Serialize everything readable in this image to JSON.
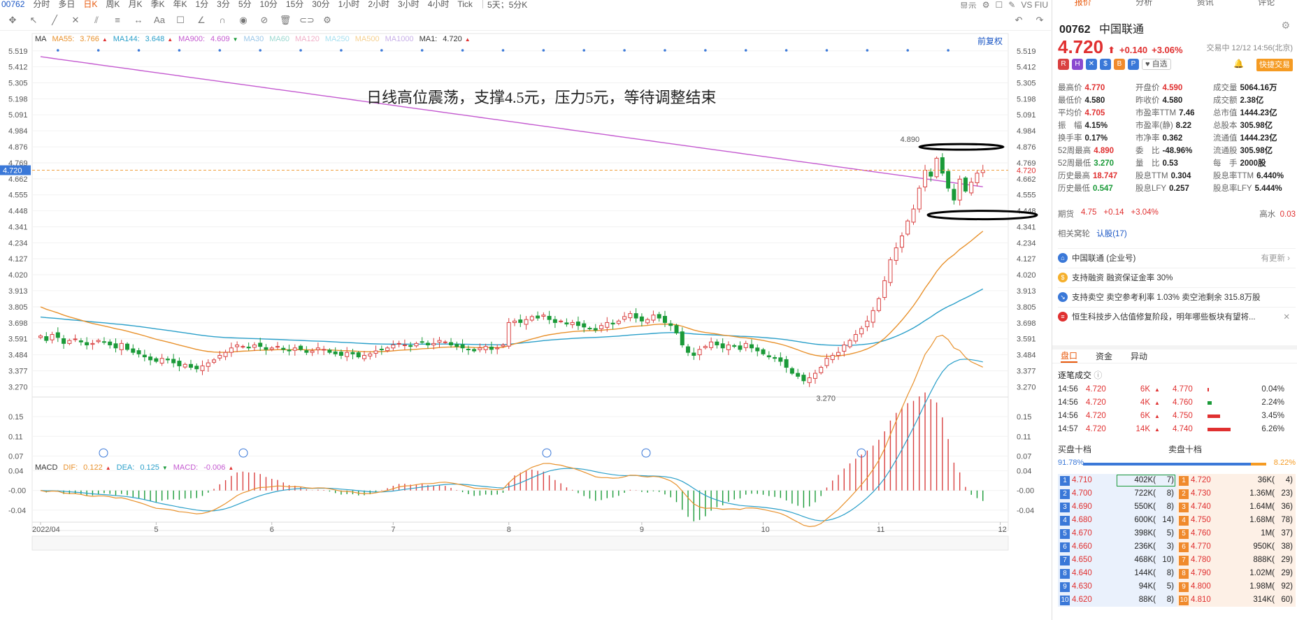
{
  "toolbar": {
    "code": "00762",
    "periods": [
      {
        "label": "分时",
        "active": false
      },
      {
        "label": "多日",
        "active": false
      },
      {
        "label": "日K",
        "active": true
      },
      {
        "label": "周K",
        "active": false
      },
      {
        "label": "月K",
        "active": false
      },
      {
        "label": "季K",
        "active": false
      },
      {
        "label": "年K",
        "active": false
      },
      {
        "label": "1分",
        "active": false
      },
      {
        "label": "3分",
        "active": false
      },
      {
        "label": "5分",
        "active": false
      },
      {
        "label": "10分",
        "active": false
      },
      {
        "label": "15分",
        "active": false
      },
      {
        "label": "30分",
        "active": false
      },
      {
        "label": "1小时",
        "active": false
      },
      {
        "label": "2小时",
        "active": false
      },
      {
        "label": "3小时",
        "active": false
      },
      {
        "label": "4小时",
        "active": false
      },
      {
        "label": "Tick",
        "active": false
      }
    ],
    "period_select": "5天；5分K",
    "display_label": "显示",
    "indicator_right": "VS FIU"
  },
  "chart": {
    "annotation": "日线高位震荡，支撑4.5元，压力5元，等待调整结束",
    "fuquan_label": "前复权",
    "current_price_tag": "4.720",
    "high_label": "4.890",
    "low_label": "3.270",
    "ma_legend": [
      {
        "label": "MA",
        "value": "",
        "color": "#333333"
      },
      {
        "label": "MA55:",
        "value": "3.766",
        "color": "#e8912c",
        "arrow": "▲"
      },
      {
        "label": "MA144:",
        "value": "3.648",
        "color": "#2a9fc9",
        "arrow": "▲"
      },
      {
        "label": "MA900:",
        "value": "4.609",
        "color": "#c45ad0",
        "arrow": "▼"
      },
      {
        "label": "MA30",
        "value": "",
        "color": "#9bc7e8"
      },
      {
        "label": "MA60",
        "value": "",
        "color": "#9bd8d0"
      },
      {
        "label": "MA120",
        "value": "",
        "color": "#f0b0c8"
      },
      {
        "label": "MA250",
        "value": "",
        "color": "#a8e0f0"
      },
      {
        "label": "MA500",
        "value": "",
        "color": "#f5d090"
      },
      {
        "label": "MA1000",
        "value": "",
        "color": "#c8b0e8"
      },
      {
        "label": "MA1:",
        "value": "4.720",
        "color": "#333333",
        "arrow": "▲"
      }
    ],
    "macd_legend": [
      {
        "label": "MACD",
        "value": "",
        "color": "#333333"
      },
      {
        "label": "DIF:",
        "value": "0.122",
        "color": "#e8912c",
        "arrow": "▲"
      },
      {
        "label": "DEA:",
        "value": "0.125",
        "color": "#2a9fc9",
        "arrow": "▼"
      },
      {
        "label": "MACD:",
        "value": "-0.006",
        "color": "#c45ad0",
        "arrow": "▲"
      }
    ],
    "price_ticks": [
      "5.519",
      "5.412",
      "5.305",
      "5.198",
      "5.091",
      "4.984",
      "4.876",
      "4.769",
      "4.662",
      "4.555",
      "4.448",
      "4.341",
      "4.234",
      "4.127",
      "4.020",
      "3.913",
      "3.805",
      "3.698",
      "3.591",
      "3.484",
      "3.377",
      "3.270"
    ],
    "macd_ticks": [
      "0.15",
      "0.11",
      "0.07",
      "0.04",
      "-0.00",
      "-0.04"
    ],
    "x_labels": [
      "2022/04",
      "5",
      "6",
      "7",
      "8",
      "9",
      "10",
      "11",
      "12"
    ]
  },
  "chart_data": {
    "type": "candlestick",
    "price_range": [
      3.22,
      5.56
    ],
    "macd_range": [
      -0.06,
      0.17
    ],
    "months": [
      {
        "label": "2022/04",
        "start_index": 0
      },
      {
        "label": "5",
        "start_index": 20
      },
      {
        "label": "6",
        "start_index": 40
      },
      {
        "label": "7",
        "start_index": 61
      },
      {
        "label": "8",
        "start_index": 81
      },
      {
        "label": "9",
        "start_index": 104
      },
      {
        "label": "10",
        "start_index": 125
      },
      {
        "label": "11",
        "start_index": 145
      },
      {
        "label": "12",
        "start_index": 166
      }
    ],
    "closes": [
      3.61,
      3.58,
      3.62,
      3.6,
      3.56,
      3.58,
      3.59,
      3.57,
      3.55,
      3.56,
      3.58,
      3.57,
      3.55,
      3.53,
      3.56,
      3.52,
      3.5,
      3.49,
      3.47,
      3.45,
      3.44,
      3.46,
      3.45,
      3.43,
      3.41,
      3.42,
      3.4,
      3.39,
      3.41,
      3.43,
      3.45,
      3.48,
      3.5,
      3.53,
      3.55,
      3.54,
      3.53,
      3.55,
      3.54,
      3.52,
      3.53,
      3.54,
      3.52,
      3.51,
      3.53,
      3.52,
      3.5,
      3.51,
      3.53,
      3.52,
      3.5,
      3.49,
      3.48,
      3.5,
      3.49,
      3.47,
      3.48,
      3.49,
      3.51,
      3.52,
      3.53,
      3.55,
      3.56,
      3.55,
      3.54,
      3.56,
      3.57,
      3.55,
      3.56,
      3.58,
      3.57,
      3.55,
      3.54,
      3.53,
      3.52,
      3.51,
      3.53,
      3.54,
      3.52,
      3.53,
      3.55,
      3.7,
      3.71,
      3.7,
      3.72,
      3.74,
      3.73,
      3.75,
      3.72,
      3.7,
      3.71,
      3.69,
      3.7,
      3.68,
      3.67,
      3.66,
      3.65,
      3.68,
      3.7,
      3.69,
      3.71,
      3.74,
      3.76,
      3.73,
      3.71,
      3.72,
      3.75,
      3.73,
      3.7,
      3.68,
      3.63,
      3.55,
      3.5,
      3.48,
      3.52,
      3.54,
      3.57,
      3.55,
      3.53,
      3.55,
      3.54,
      3.52,
      3.56,
      3.53,
      3.51,
      3.49,
      3.47,
      3.46,
      3.44,
      3.4,
      3.36,
      3.34,
      3.31,
      3.33,
      3.36,
      3.4,
      3.46,
      3.48,
      3.5,
      3.55,
      3.58,
      3.62,
      3.66,
      3.71,
      3.78,
      3.86,
      3.98,
      4.12,
      4.2,
      4.28,
      4.38,
      4.46,
      4.6,
      4.72,
      4.68,
      4.8,
      4.7,
      4.6,
      4.52,
      4.66,
      4.58,
      4.64,
      4.7,
      4.72
    ],
    "ma900": {
      "start": 5.48,
      "end": 4.609
    },
    "ma55_last": 3.766,
    "ma144_last": 3.648,
    "high": 4.89,
    "low": 3.27,
    "macd": {
      "dif": 0.122,
      "dea": 0.125,
      "macd": -0.006
    }
  },
  "panel": {
    "tabs": [
      {
        "label": "报价",
        "active": true
      },
      {
        "label": "分析",
        "active": false
      },
      {
        "label": "资讯",
        "active": false
      },
      {
        "label": "评论",
        "active": false
      }
    ],
    "code": "00762",
    "name": "中国联通",
    "price": "4.720",
    "arrow": "⬆",
    "change": "+0.140",
    "change_pct": "+3.06%",
    "trade_time": "交易中 12/12 14:56(北京)",
    "fav_label": "自选",
    "quick_trade": "快捷交易",
    "flags": [
      {
        "sym": "R",
        "color": "#d94040"
      },
      {
        "sym": "H",
        "color": "#8a4ad0"
      },
      {
        "sym": "✕",
        "color": "#3a78d8"
      },
      {
        "sym": "$",
        "color": "#3a78d8"
      },
      {
        "sym": "B",
        "color": "#f08a2c"
      },
      {
        "sym": "P",
        "color": "#3a78d8"
      }
    ],
    "quote_items": [
      {
        "label": "最高价",
        "value": "4.770",
        "tone": "red"
      },
      {
        "label": "开盘价",
        "value": "4.590",
        "tone": "red"
      },
      {
        "label": "成交量",
        "value": "5064.16万",
        "tone": "dark"
      },
      {
        "label": "最低价",
        "value": "4.580",
        "tone": "dark"
      },
      {
        "label": "昨收价",
        "value": "4.580",
        "tone": "dark"
      },
      {
        "label": "成交额",
        "value": "2.38亿",
        "tone": "dark"
      },
      {
        "label": "平均价",
        "value": "4.705",
        "tone": "red"
      },
      {
        "label": "市盈率TTM",
        "value": "7.46",
        "tone": "dark"
      },
      {
        "label": "总市值",
        "value": "1444.23亿",
        "tone": "dark"
      },
      {
        "label": "振　幅",
        "value": "4.15%",
        "tone": "dark"
      },
      {
        "label": "市盈率(静)",
        "value": "8.22",
        "tone": "dark"
      },
      {
        "label": "总股本",
        "value": "305.98亿",
        "tone": "dark"
      },
      {
        "label": "换手率",
        "value": "0.17%",
        "tone": "dark"
      },
      {
        "label": "市净率",
        "value": "0.362",
        "tone": "dark"
      },
      {
        "label": "流通值",
        "value": "1444.23亿",
        "tone": "dark"
      },
      {
        "label": "52周最高",
        "value": "4.890",
        "tone": "red"
      },
      {
        "label": "委　比",
        "value": "-48.96%",
        "tone": "dark"
      },
      {
        "label": "流通股",
        "value": "305.98亿",
        "tone": "dark"
      },
      {
        "label": "52周最低",
        "value": "3.270",
        "tone": "green"
      },
      {
        "label": "量　比",
        "value": "0.53",
        "tone": "dark"
      },
      {
        "label": "每　手",
        "value": "2000股",
        "tone": "dark"
      },
      {
        "label": "历史最高",
        "value": "18.747",
        "tone": "red"
      },
      {
        "label": "股息TTM",
        "value": "0.304",
        "tone": "dark"
      },
      {
        "label": "股息率TTM",
        "value": "6.440%",
        "tone": "dark"
      },
      {
        "label": "历史最低",
        "value": "0.547",
        "tone": "green"
      },
      {
        "label": "股息LFY",
        "value": "0.257",
        "tone": "dark"
      },
      {
        "label": "股息率LFY",
        "value": "5.444%",
        "tone": "dark"
      }
    ],
    "futures": {
      "label": "期货",
      "price": "4.75",
      "chg": "+0.14",
      "pct": "+3.04%",
      "hs_label": "高水",
      "hs_value": "0.03"
    },
    "related": {
      "label": "相关窝轮",
      "link": "认股(17)"
    },
    "notices": [
      {
        "text": "中国联通 (企业号)",
        "more": "有更新 ›",
        "icon": "⌂",
        "color": "#3a78d8"
      },
      {
        "text": "支持融资 融资保证金率 30%",
        "more": "",
        "icon": "$",
        "color": "#f5b02c"
      },
      {
        "text": "支持卖空 卖空参考利率 1.03% 卖空池剩余 315.8万股",
        "more": "",
        "icon": "↘",
        "color": "#3a78d8"
      },
      {
        "text": "恒生科技步入估值修复阶段，明年哪些板块有望将...",
        "more": "✕",
        "icon": "≡",
        "color": "#e03030"
      }
    ],
    "pan_tabs": [
      "盘口",
      "资金",
      "异动"
    ],
    "zb_title": "逐笔成交",
    "ticks": [
      {
        "time": "14:56",
        "price": "4.720",
        "vol": "6K",
        "dir": "▲",
        "lp": "4.770",
        "bar": 0.02,
        "bar_color": "#e03030",
        "pct": "0.04%"
      },
      {
        "time": "14:56",
        "price": "4.720",
        "vol": "4K",
        "dir": "▲",
        "lp": "4.760",
        "bar": 0.1,
        "bar_color": "#1a9a38",
        "pct": "2.24%"
      },
      {
        "time": "14:56",
        "price": "4.720",
        "vol": "6K",
        "dir": "▲",
        "lp": "4.750",
        "bar": 0.3,
        "bar_color": "#e03030",
        "pct": "3.45%"
      },
      {
        "time": "14:57",
        "price": "4.720",
        "vol": "14K",
        "dir": "▲",
        "lp": "4.740",
        "bar": 0.55,
        "bar_color": "#e03030",
        "pct": "6.26%"
      }
    ],
    "book_head": {
      "buy": "买盘十档",
      "sell": "卖盘十档"
    },
    "ratio": {
      "buy": "91.78%",
      "sell": "8.22%",
      "sell_fraction": 0.0822
    },
    "book": [
      {
        "lvl": "1",
        "bp": "4.710",
        "bv": "402K(",
        "bn": "7)",
        "sp": "4.720",
        "sv": "36K(",
        "sn": "4)"
      },
      {
        "lvl": "2",
        "bp": "4.700",
        "bv": "722K(",
        "bn": "8)",
        "sp": "4.730",
        "sv": "1.36M(",
        "sn": "23)"
      },
      {
        "lvl": "3",
        "bp": "4.690",
        "bv": "550K(",
        "bn": "8)",
        "sp": "4.740",
        "sv": "1.64M(",
        "sn": "36)"
      },
      {
        "lvl": "4",
        "bp": "4.680",
        "bv": "600K(",
        "bn": "14)",
        "sp": "4.750",
        "sv": "1.68M(",
        "sn": "78)"
      },
      {
        "lvl": "5",
        "bp": "4.670",
        "bv": "398K(",
        "bn": "5)",
        "sp": "4.760",
        "sv": "1M(",
        "sn": "37)"
      },
      {
        "lvl": "6",
        "bp": "4.660",
        "bv": "236K(",
        "bn": "3)",
        "sp": "4.770",
        "sv": "950K(",
        "sn": "38)"
      },
      {
        "lvl": "7",
        "bp": "4.650",
        "bv": "468K(",
        "bn": "10)",
        "sp": "4.780",
        "sv": "888K(",
        "sn": "29)"
      },
      {
        "lvl": "8",
        "bp": "4.640",
        "bv": "144K(",
        "bn": "8)",
        "sp": "4.790",
        "sv": "1.02M(",
        "sn": "29)"
      },
      {
        "lvl": "9",
        "bp": "4.630",
        "bv": "94K(",
        "bn": "5)",
        "sp": "4.800",
        "sv": "1.98M(",
        "sn": "92)"
      },
      {
        "lvl": "10",
        "bp": "4.620",
        "bv": "88K(",
        "bn": "8)",
        "sp": "4.810",
        "sv": "314K(",
        "sn": "60)"
      }
    ]
  }
}
